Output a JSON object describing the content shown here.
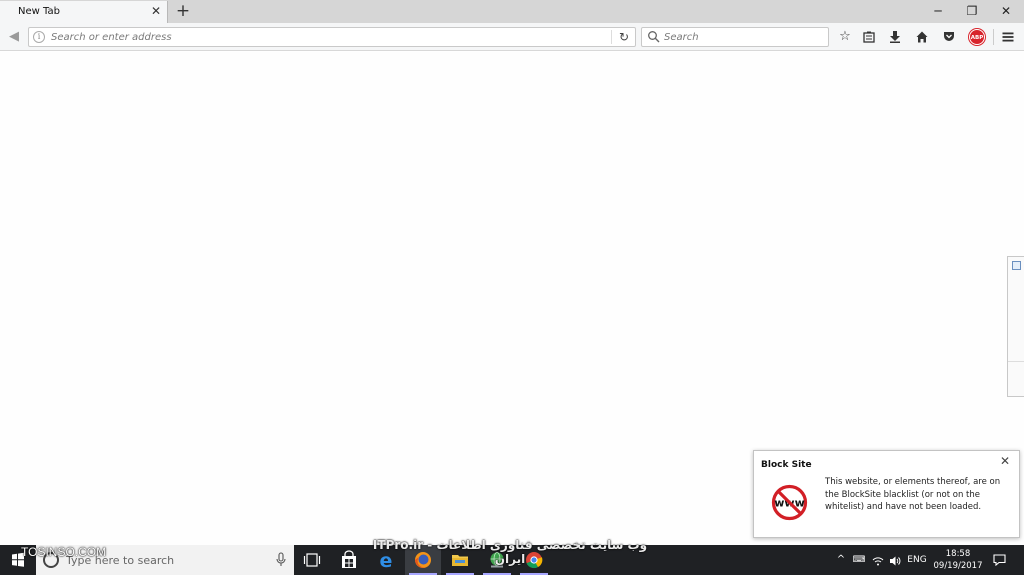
{
  "browser": {
    "tab": {
      "title": "New Tab"
    },
    "urlbar": {
      "placeholder": "Search or enter address"
    },
    "searchbar": {
      "placeholder": "Search"
    },
    "abp_label": "ABP"
  },
  "notification": {
    "title": "Block Site",
    "message": "This website, or elements thereof, are on the BlockSite blacklist (or not on the whitelist) and have not been loaded.",
    "icon_text": "www"
  },
  "watermarks": {
    "left": "TOSINSO.COM",
    "center": "ITPro.ir - وب سایت تخصصی فناوری اطلاعات ایران"
  },
  "taskbar": {
    "search_placeholder": "Type here to search",
    "language": "ENG",
    "time": "18:58",
    "date": "09/19/2017"
  },
  "colors": {
    "tabstrip": "#d6d6d6",
    "toolbar": "#f5f6f7",
    "taskbar": "#1f2124",
    "block_icon_red": "#d21f26",
    "abp_red": "#d8242c"
  }
}
